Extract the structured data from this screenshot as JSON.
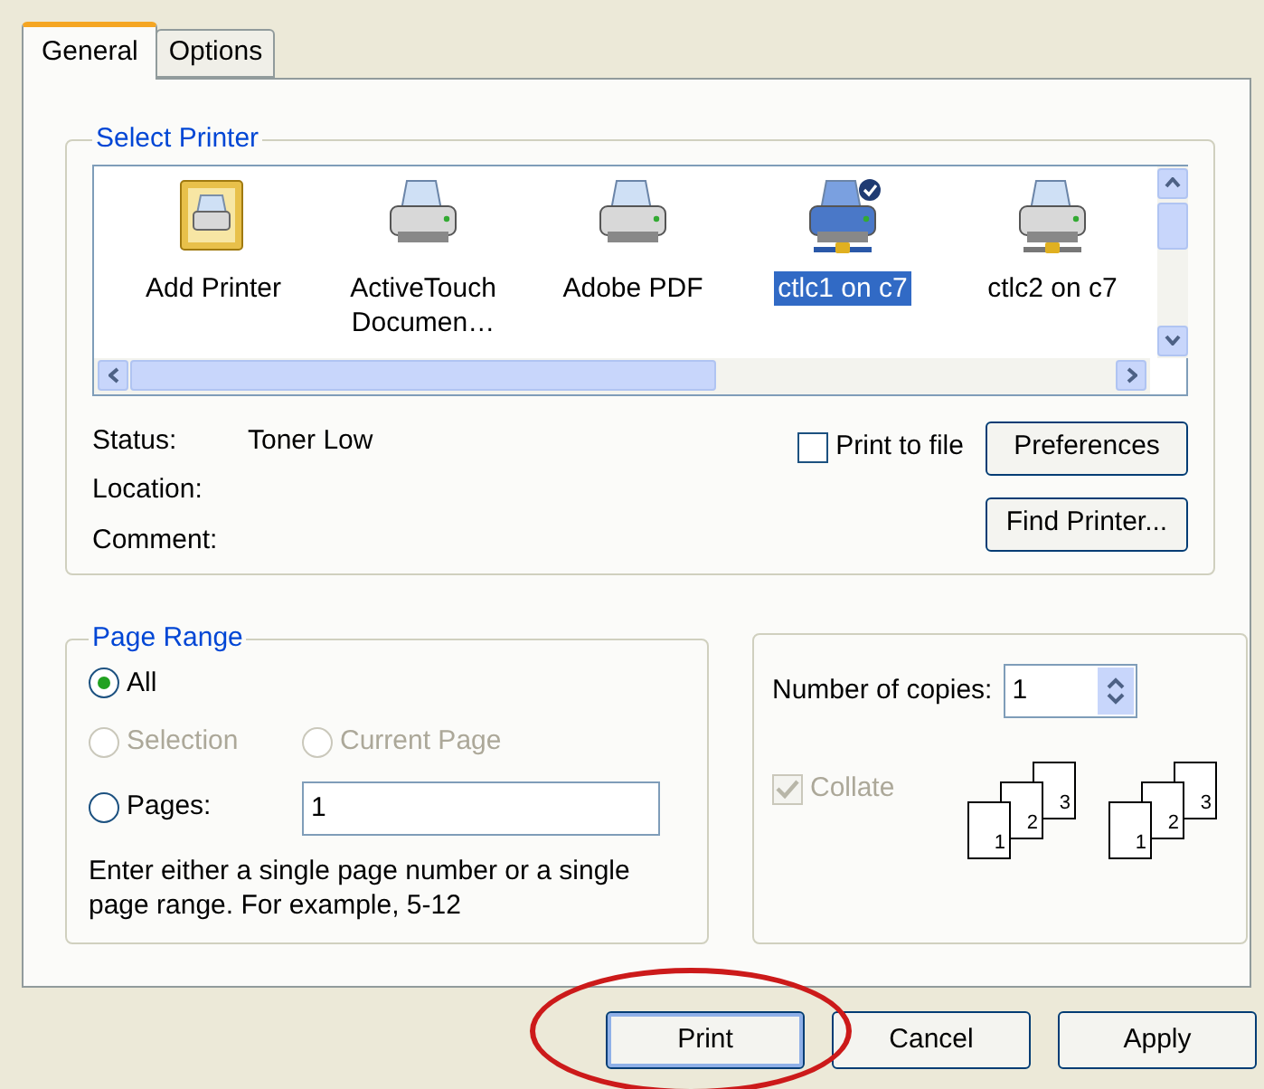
{
  "tabs": [
    {
      "label": "General",
      "selected": true
    },
    {
      "label": "Options",
      "selected": false
    }
  ],
  "select_printer": {
    "title": "Select Printer",
    "printers": [
      {
        "label": "Add Printer",
        "kind": "add",
        "selected": false,
        "default": false
      },
      {
        "label": "ActiveTouch Documen…",
        "kind": "printer",
        "selected": false,
        "default": false
      },
      {
        "label": "Adobe PDF",
        "kind": "printer",
        "selected": false,
        "default": false
      },
      {
        "label": "ctlc1 on c7",
        "kind": "network",
        "selected": true,
        "default": true
      },
      {
        "label": "ctlc2 on c7",
        "kind": "network",
        "selected": false,
        "default": false
      }
    ],
    "info": [
      {
        "label": "Status:",
        "value": "Toner Low"
      },
      {
        "label": "Location:"
      },
      {
        "label": "Comment:"
      }
    ],
    "print_to_file": {
      "label": "Print to file",
      "checked": false
    },
    "buttons": [
      "Preferences",
      "Find Printer..."
    ]
  },
  "page_range": {
    "title": "Page Range",
    "options": [
      {
        "label": "All",
        "selected": true,
        "disabled": false
      },
      {
        "label": "Selection",
        "selected": false,
        "disabled": true
      },
      {
        "label": "Current Page",
        "selected": false,
        "disabled": true
      },
      {
        "label": "Pages:",
        "selected": false,
        "disabled": false
      }
    ],
    "pages_value": "1",
    "hint": "Enter either a single page number or a single page range.  For example, 5-12"
  },
  "copies": {
    "label": "Number of copies:",
    "value": "1",
    "collate": {
      "label": "Collate",
      "checked": true,
      "disabled": true
    },
    "illustrations": [
      {
        "pages": [
          "1",
          "2",
          "3"
        ]
      },
      {
        "pages": [
          "1",
          "2",
          "3"
        ]
      }
    ]
  },
  "buttons": [
    "Print",
    "Cancel",
    "Apply"
  ]
}
